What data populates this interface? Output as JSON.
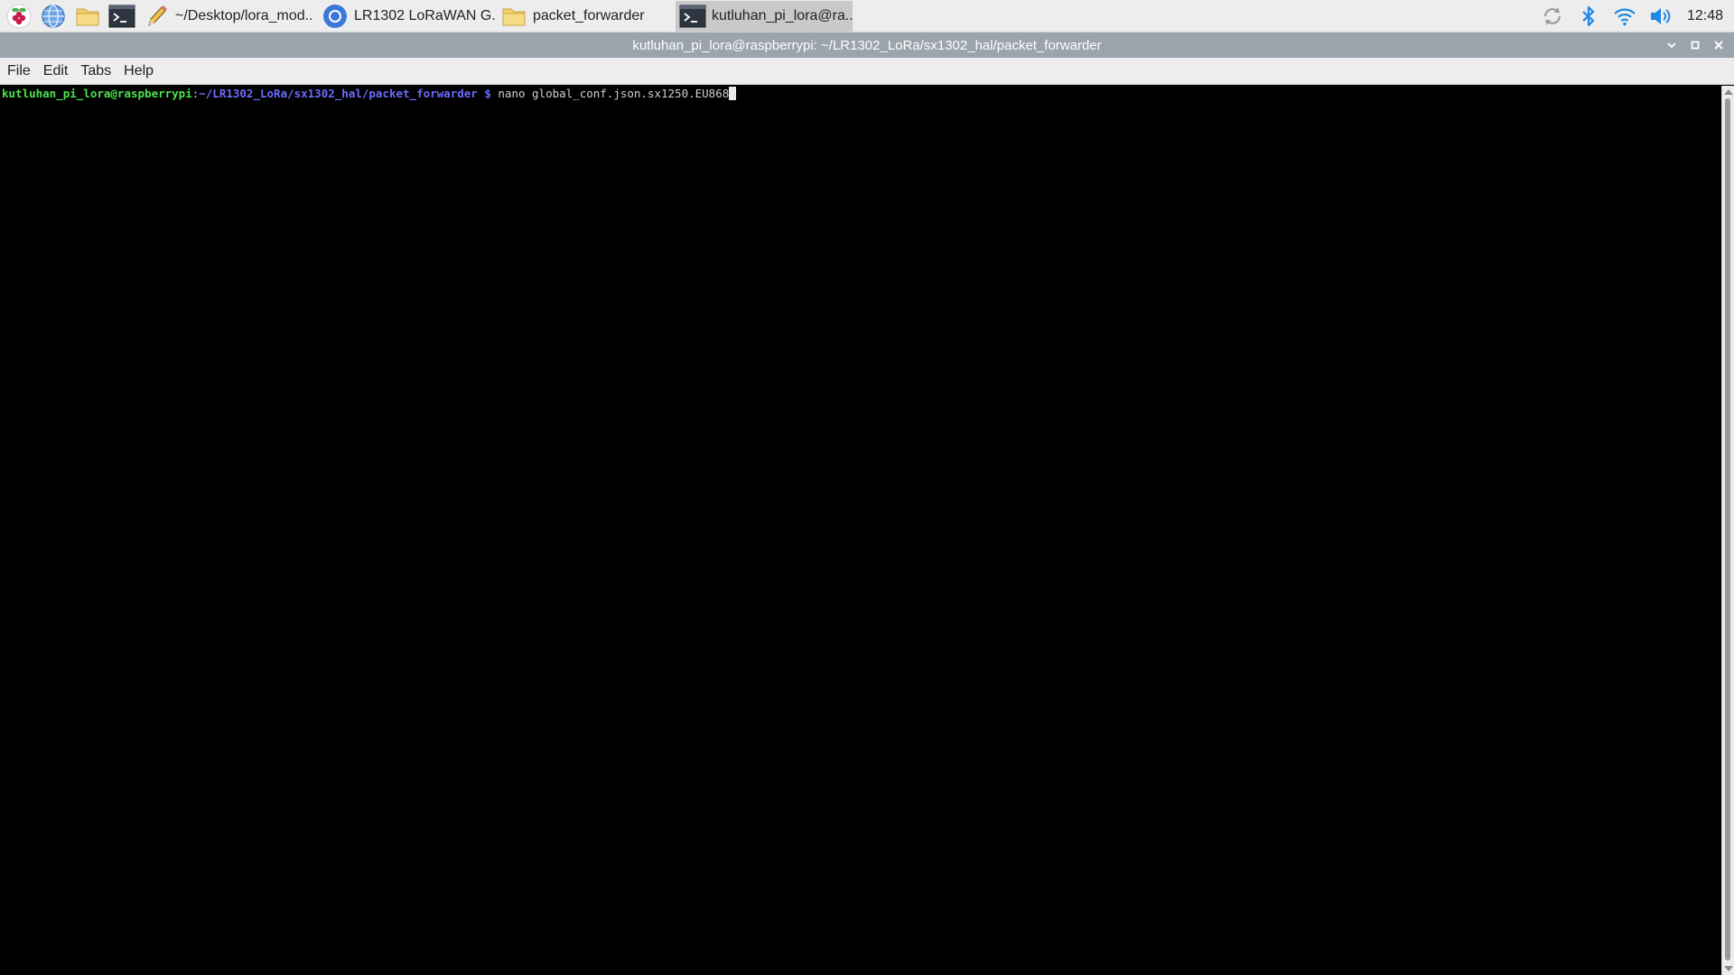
{
  "taskbar": {
    "launchers": [
      {
        "name": "raspberry-menu-icon"
      },
      {
        "name": "web-browser-icon"
      },
      {
        "name": "file-manager-icon"
      },
      {
        "name": "terminal-launcher-icon"
      }
    ],
    "tasks": [
      {
        "label": "~/Desktop/lora_mod..",
        "icon": "text-editor-icon",
        "active": false
      },
      {
        "label": "LR1302 LoRaWAN G..",
        "icon": "chromium-icon",
        "active": false
      },
      {
        "label": "packet_forwarder",
        "icon": "folder-icon",
        "active": false
      },
      {
        "label": "kutluhan_pi_lora@ra..",
        "icon": "terminal-icon",
        "active": true
      }
    ],
    "tray": {
      "icons": [
        "updates-icon",
        "bluetooth-icon",
        "wifi-icon",
        "volume-icon"
      ],
      "clock": "12:48"
    }
  },
  "window": {
    "title": "kutluhan_pi_lora@raspberrypi: ~/LR1302_LoRa/sx1302_hal/packet_forwarder"
  },
  "menu": {
    "items": [
      "File",
      "Edit",
      "Tabs",
      "Help"
    ]
  },
  "terminal": {
    "prompt_user": "kutluhan_pi_lora@raspberrypi",
    "prompt_sep": ":",
    "prompt_path": "~/LR1302_LoRa/sx1302_hal/packet_forwarder",
    "prompt_dollar": " $ ",
    "command": "nano global_conf.json.sx1250.EU868"
  },
  "colors": {
    "prompt_user": "#4ee24e",
    "prompt_path": "#6b6bff",
    "command_text": "#d0d0d0",
    "titlebar": "#9ba3ad",
    "taskbar": "#ededed"
  }
}
